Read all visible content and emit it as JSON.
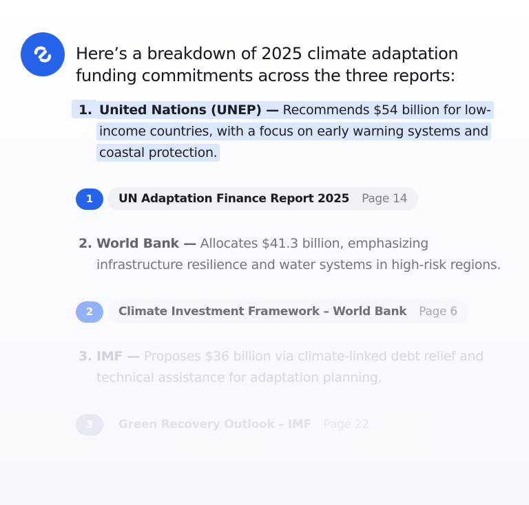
{
  "assistant": {
    "avatar_icon": "assistant-logo-icon",
    "accent_color": "#2563eb"
  },
  "message": {
    "intro": "Here’s a breakdown of 2025 climate adaptation funding commitments across the three reports:"
  },
  "items": [
    {
      "number": "1.",
      "name": "United Nations (UNEP) —",
      "text": " Recommends $54 billion for low-income countries, with a focus on early warning systems and coastal protection.",
      "citation": {
        "index": "1",
        "title": "UN Adaptation Finance Report 2025",
        "page": "Page 14"
      }
    },
    {
      "number": "2.",
      "name": "World Bank —",
      "text": " Allocates $41.3 billion, emphasizing infrastructure resilience and water systems in high-risk regions.",
      "citation": {
        "index": "2",
        "title": "Climate Investment Framework – World Bank",
        "page": "Page 6"
      }
    },
    {
      "number": "3.",
      "name": "IMF —",
      "text": " Proposes $36 billion via climate-linked debt relief and technical assistance for adaptation planning.",
      "citation": {
        "index": "3",
        "title": "Green Recovery Outlook – IMF",
        "page": "Page 22"
      }
    }
  ]
}
